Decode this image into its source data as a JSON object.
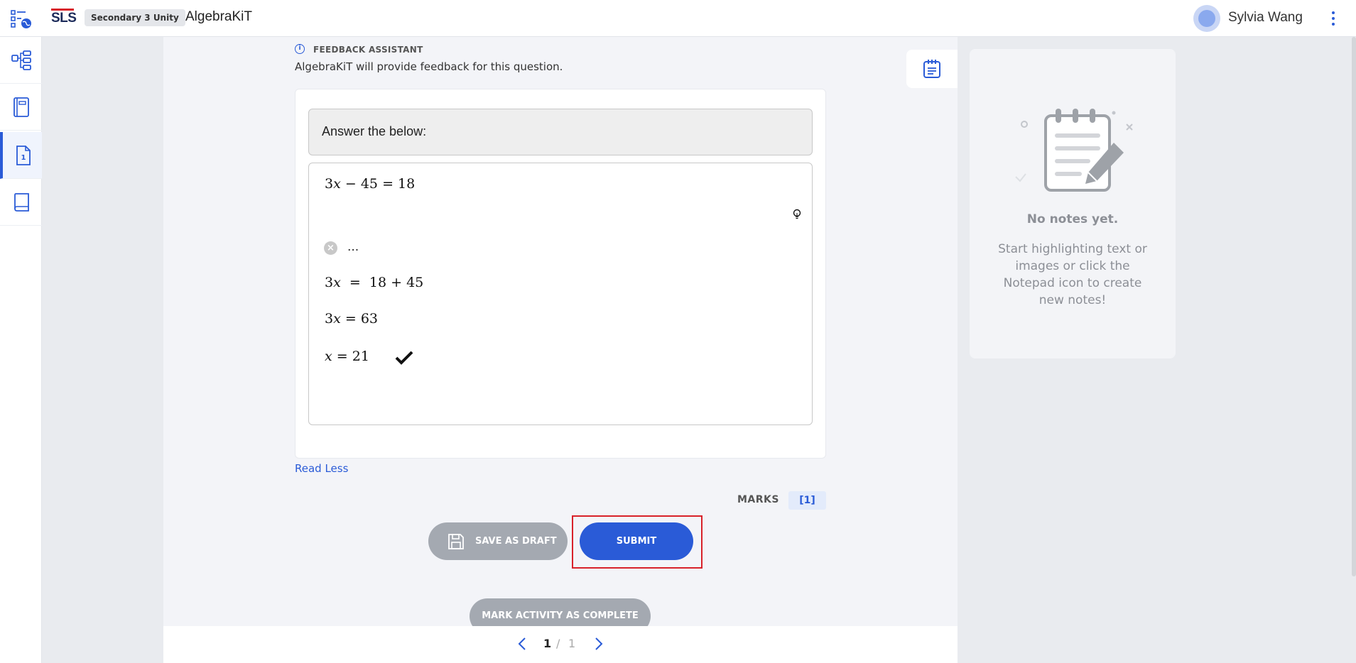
{
  "header": {
    "logo": "SLS",
    "class_badge": "Secondary 3 Unity",
    "app_title": "AlgebraKiT",
    "user_name": "Sylvia Wang"
  },
  "rail": {
    "items": [
      {
        "icon": "tasks-globe-icon"
      },
      {
        "icon": "lesson-map-icon"
      },
      {
        "icon": "notebook-icon"
      },
      {
        "icon": "page-1-icon",
        "label": "1",
        "active": true
      },
      {
        "icon": "book-icon"
      }
    ]
  },
  "feedback": {
    "title": "FEEDBACK ASSISTANT",
    "description": "AlgebraKiT will provide feedback for this question."
  },
  "question": {
    "prompt": "Answer the below:",
    "equation": {
      "lhs_coef": "3",
      "lhs_var": "x",
      "op": "−",
      "lhs_const": "45",
      "eq": "=",
      "rhs": "18"
    },
    "error_text": "...",
    "steps": [
      {
        "coef": "3",
        "var": "x",
        "eq": "=",
        "rhs": "18 + 45"
      },
      {
        "coef": "3",
        "var": "x",
        "eq": "=",
        "rhs": "63"
      },
      {
        "coef": "",
        "var": "x",
        "eq": "=",
        "rhs": "21",
        "correct": true
      }
    ]
  },
  "read_less": "Read Less",
  "marks": {
    "label": "MARKS",
    "value": "[1]"
  },
  "buttons": {
    "save_draft": "SAVE AS DRAFT",
    "submit": "SUBMIT",
    "mark_complete": "MARK ACTIVITY AS COMPLETE"
  },
  "pager": {
    "current": "1",
    "separator": "/",
    "total": "1"
  },
  "notes": {
    "title": "No notes yet.",
    "description": "Start highlighting text or images or click the Notepad icon to create new notes!"
  },
  "colors": {
    "accent": "#2a5bd7",
    "highlight": "#d8222a",
    "disabled": "#a4a9b1"
  }
}
